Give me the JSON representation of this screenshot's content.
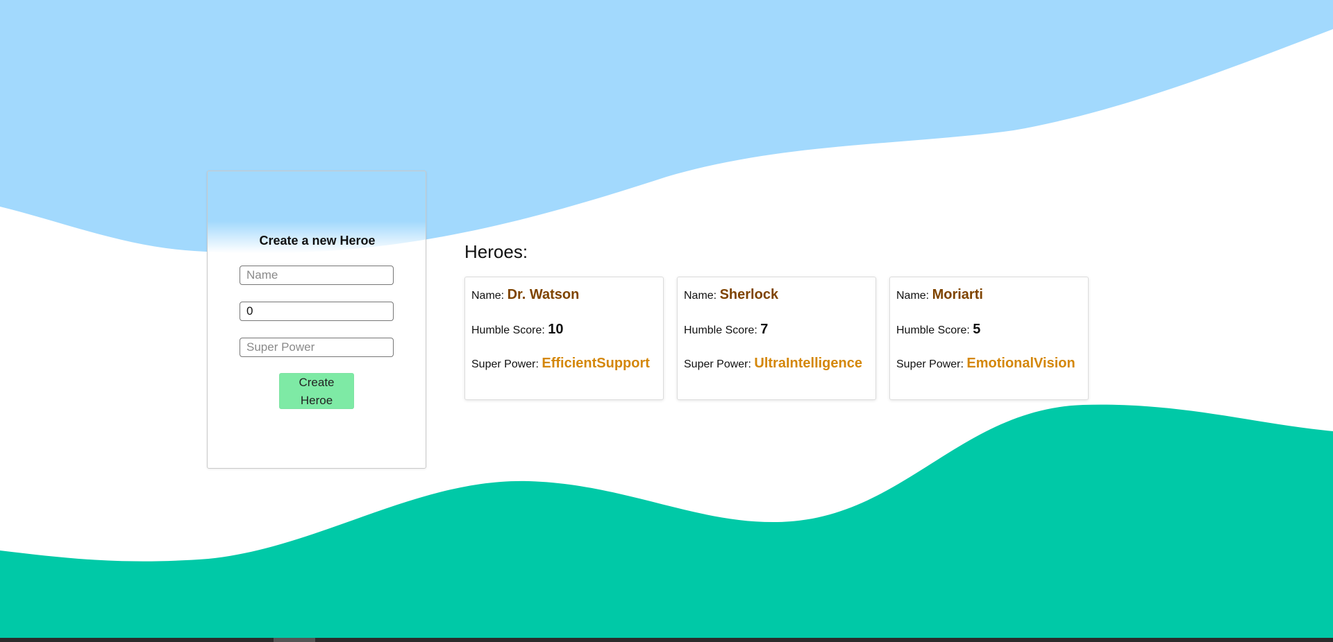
{
  "form": {
    "title": "Create a new Heroe",
    "name_placeholder": "Name",
    "score_value": "0",
    "power_placeholder": "Super Power",
    "submit_label": "Create Heroe"
  },
  "heroes": {
    "heading": "Heroes:",
    "labels": {
      "name": "Name:",
      "score": "Humble Score:",
      "power": "Super Power:"
    },
    "items": [
      {
        "name": "Dr. Watson",
        "score": "10",
        "power": "EfficientSupport"
      },
      {
        "name": "Sherlock",
        "score": "7",
        "power": "UltraIntelligence"
      },
      {
        "name": "Moriarti",
        "score": "5",
        "power": "EmotionalVision"
      }
    ]
  },
  "colors": {
    "top_wave": "#a2d9fd",
    "bottom_wave": "#00c9a7",
    "button": "#7eeaa5",
    "hero_name": "#7f4400",
    "super_power": "#d4870a"
  }
}
